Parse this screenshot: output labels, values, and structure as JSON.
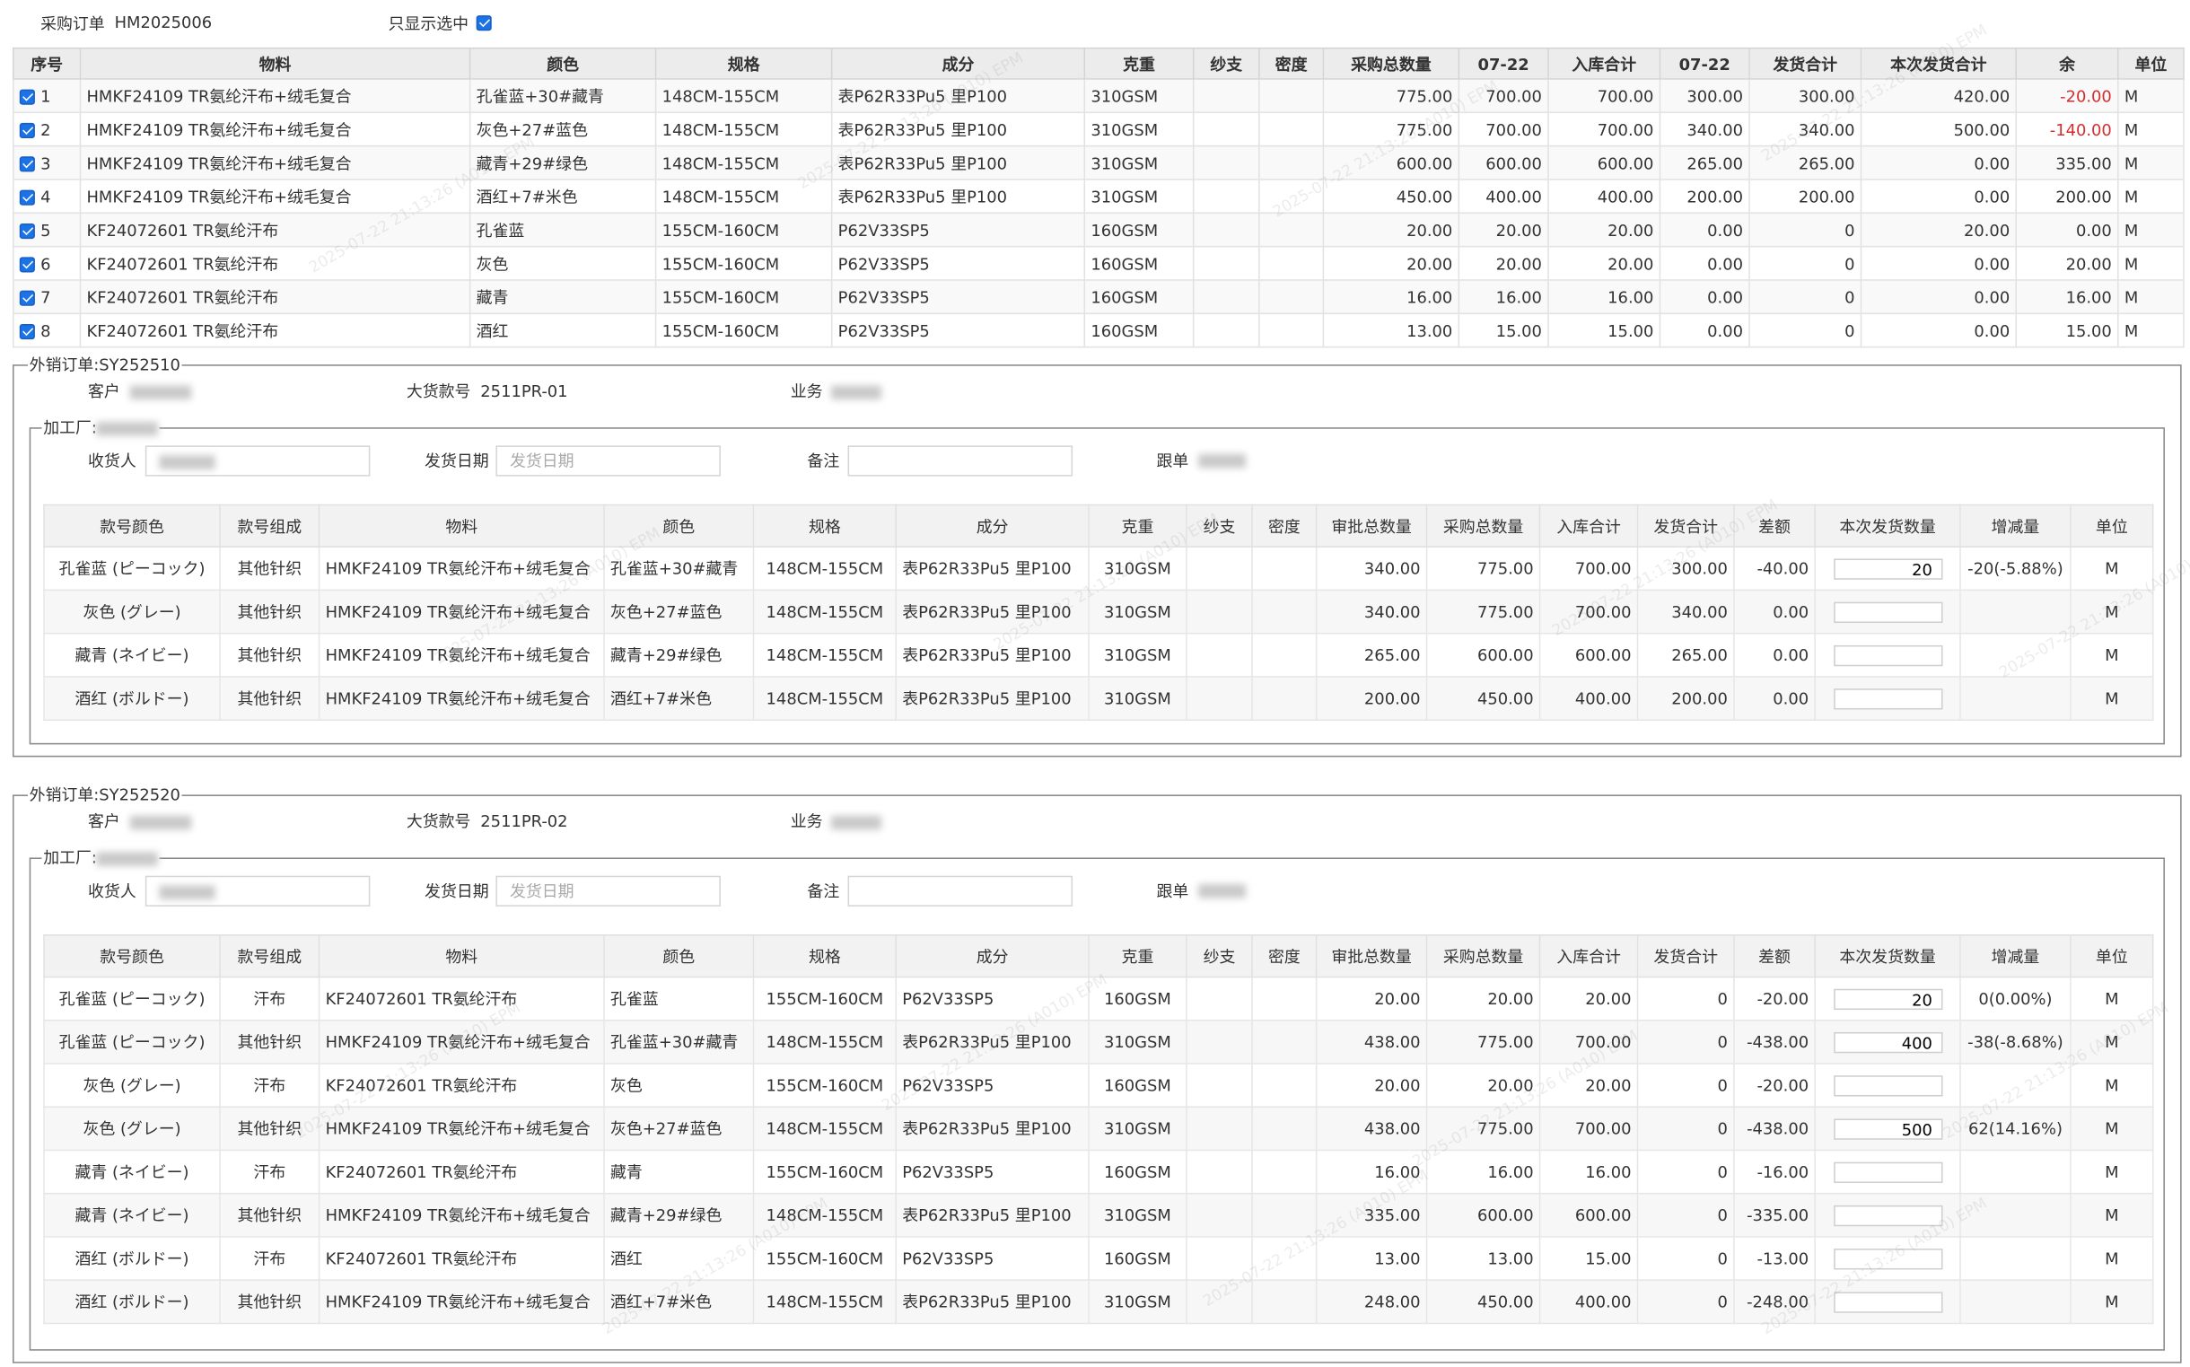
{
  "header": {
    "po_label": "采购订单",
    "po_number": "HM2025006",
    "show_selected_label": "只显示选中"
  },
  "top_table": {
    "columns": [
      "序号",
      "物料",
      "颜色",
      "规格",
      "成分",
      "克重",
      "纱支",
      "密度",
      "采购总数量",
      "07-22",
      "入库合计",
      "07-22",
      "发货合计",
      "本次发货合计",
      "余",
      "单位"
    ],
    "rows": [
      {
        "no": "1",
        "material": "HMKF24109 TR氨纶汗布+绒毛复合",
        "color": "孔雀蓝+30#藏青",
        "spec": "148CM-155CM",
        "comp": "表P62R33Pu5 里P100",
        "weight": "310GSM",
        "yarn": "",
        "density": "",
        "po_qty": "775.00",
        "d1": "700.00",
        "in_total": "700.00",
        "d2": "300.00",
        "ship_total": "300.00",
        "this_ship": "420.00",
        "rest": "-20.00",
        "unit": "M"
      },
      {
        "no": "2",
        "material": "HMKF24109 TR氨纶汗布+绒毛复合",
        "color": "灰色+27#蓝色",
        "spec": "148CM-155CM",
        "comp": "表P62R33Pu5 里P100",
        "weight": "310GSM",
        "yarn": "",
        "density": "",
        "po_qty": "775.00",
        "d1": "700.00",
        "in_total": "700.00",
        "d2": "340.00",
        "ship_total": "340.00",
        "this_ship": "500.00",
        "rest": "-140.00",
        "unit": "M"
      },
      {
        "no": "3",
        "material": "HMKF24109 TR氨纶汗布+绒毛复合",
        "color": "藏青+29#绿色",
        "spec": "148CM-155CM",
        "comp": "表P62R33Pu5 里P100",
        "weight": "310GSM",
        "yarn": "",
        "density": "",
        "po_qty": "600.00",
        "d1": "600.00",
        "in_total": "600.00",
        "d2": "265.00",
        "ship_total": "265.00",
        "this_ship": "0.00",
        "rest": "335.00",
        "unit": "M"
      },
      {
        "no": "4",
        "material": "HMKF24109 TR氨纶汗布+绒毛复合",
        "color": "酒红+7#米色",
        "spec": "148CM-155CM",
        "comp": "表P62R33Pu5 里P100",
        "weight": "310GSM",
        "yarn": "",
        "density": "",
        "po_qty": "450.00",
        "d1": "400.00",
        "in_total": "400.00",
        "d2": "200.00",
        "ship_total": "200.00",
        "this_ship": "0.00",
        "rest": "200.00",
        "unit": "M"
      },
      {
        "no": "5",
        "material": "KF24072601 TR氨纶汗布",
        "color": "孔雀蓝",
        "spec": "155CM-160CM",
        "comp": "P62V33SP5",
        "weight": "160GSM",
        "yarn": "",
        "density": "",
        "po_qty": "20.00",
        "d1": "20.00",
        "in_total": "20.00",
        "d2": "0.00",
        "ship_total": "0",
        "this_ship": "20.00",
        "rest": "0.00",
        "unit": "M"
      },
      {
        "no": "6",
        "material": "KF24072601 TR氨纶汗布",
        "color": "灰色",
        "spec": "155CM-160CM",
        "comp": "P62V33SP5",
        "weight": "160GSM",
        "yarn": "",
        "density": "",
        "po_qty": "20.00",
        "d1": "20.00",
        "in_total": "20.00",
        "d2": "0.00",
        "ship_total": "0",
        "this_ship": "0.00",
        "rest": "20.00",
        "unit": "M"
      },
      {
        "no": "7",
        "material": "KF24072601 TR氨纶汗布",
        "color": "藏青",
        "spec": "155CM-160CM",
        "comp": "P62V33SP5",
        "weight": "160GSM",
        "yarn": "",
        "density": "",
        "po_qty": "16.00",
        "d1": "16.00",
        "in_total": "16.00",
        "d2": "0.00",
        "ship_total": "0",
        "this_ship": "0.00",
        "rest": "16.00",
        "unit": "M"
      },
      {
        "no": "8",
        "material": "KF24072601 TR氨纶汗布",
        "color": "酒红",
        "spec": "155CM-160CM",
        "comp": "P62V33SP5",
        "weight": "160GSM",
        "yarn": "",
        "density": "",
        "po_qty": "13.00",
        "d1": "15.00",
        "in_total": "15.00",
        "d2": "0.00",
        "ship_total": "0",
        "this_ship": "0.00",
        "rest": "15.00",
        "unit": "M"
      }
    ]
  },
  "sub_columns": [
    "款号颜色",
    "款号组成",
    "物料",
    "颜色",
    "规格",
    "成分",
    "克重",
    "纱支",
    "密度",
    "审批总数量",
    "采购总数量",
    "入库合计",
    "发货合计",
    "差额",
    "本次发货数量",
    "增减量",
    "单位"
  ],
  "labels": {
    "customer": "客户",
    "style_no": "大货款号",
    "business": "业务",
    "receiver": "收货人",
    "ship_date": "发货日期",
    "ship_date_placeholder": "发货日期",
    "remark": "备注",
    "follow": "跟单"
  },
  "orders": [
    {
      "legend": "外销订单:SY252510",
      "style_no": "2511PR-01",
      "factory_legend": "加工厂:",
      "rows": [
        {
          "style_color": "孔雀蓝 (ピーコック)",
          "comp_type": "其他针织",
          "material": "HMKF24109 TR氨纶汗布+绒毛复合",
          "color": "孔雀蓝+30#藏青",
          "spec": "148CM-155CM",
          "comp": "表P62R33Pu5 里P100",
          "weight": "310GSM",
          "yarn": "",
          "density": "",
          "approve": "340.00",
          "po": "775.00",
          "in": "700.00",
          "ship": "300.00",
          "diff": "-40.00",
          "qty": "20",
          "delta": "-20(-5.88%)",
          "unit": "M"
        },
        {
          "style_color": "灰色 (グレー)",
          "comp_type": "其他针织",
          "material": "HMKF24109 TR氨纶汗布+绒毛复合",
          "color": "灰色+27#蓝色",
          "spec": "148CM-155CM",
          "comp": "表P62R33Pu5 里P100",
          "weight": "310GSM",
          "yarn": "",
          "density": "",
          "approve": "340.00",
          "po": "775.00",
          "in": "700.00",
          "ship": "340.00",
          "diff": "0.00",
          "qty": "",
          "delta": "",
          "unit": "M"
        },
        {
          "style_color": "藏青 (ネイビー)",
          "comp_type": "其他针织",
          "material": "HMKF24109 TR氨纶汗布+绒毛复合",
          "color": "藏青+29#绿色",
          "spec": "148CM-155CM",
          "comp": "表P62R33Pu5 里P100",
          "weight": "310GSM",
          "yarn": "",
          "density": "",
          "approve": "265.00",
          "po": "600.00",
          "in": "600.00",
          "ship": "265.00",
          "diff": "0.00",
          "qty": "",
          "delta": "",
          "unit": "M"
        },
        {
          "style_color": "酒红 (ボルドー)",
          "comp_type": "其他针织",
          "material": "HMKF24109 TR氨纶汗布+绒毛复合",
          "color": "酒红+7#米色",
          "spec": "148CM-155CM",
          "comp": "表P62R33Pu5 里P100",
          "weight": "310GSM",
          "yarn": "",
          "density": "",
          "approve": "200.00",
          "po": "450.00",
          "in": "400.00",
          "ship": "200.00",
          "diff": "0.00",
          "qty": "",
          "delta": "",
          "unit": "M"
        }
      ]
    },
    {
      "legend": "外销订单:SY252520",
      "style_no": "2511PR-02",
      "factory_legend": "加工厂:",
      "rows": [
        {
          "style_color": "孔雀蓝 (ピーコック)",
          "comp_type": "汗布",
          "material": "KF24072601 TR氨纶汗布",
          "color": "孔雀蓝",
          "spec": "155CM-160CM",
          "comp": "P62V33SP5",
          "weight": "160GSM",
          "yarn": "",
          "density": "",
          "approve": "20.00",
          "po": "20.00",
          "in": "20.00",
          "ship": "0",
          "diff": "-20.00",
          "qty": "20",
          "delta": "0(0.00%)",
          "unit": "M"
        },
        {
          "style_color": "孔雀蓝 (ピーコック)",
          "comp_type": "其他针织",
          "material": "HMKF24109 TR氨纶汗布+绒毛复合",
          "color": "孔雀蓝+30#藏青",
          "spec": "148CM-155CM",
          "comp": "表P62R33Pu5 里P100",
          "weight": "310GSM",
          "yarn": "",
          "density": "",
          "approve": "438.00",
          "po": "775.00",
          "in": "700.00",
          "ship": "0",
          "diff": "-438.00",
          "qty": "400",
          "delta": "-38(-8.68%)",
          "unit": "M"
        },
        {
          "style_color": "灰色 (グレー)",
          "comp_type": "汗布",
          "material": "KF24072601 TR氨纶汗布",
          "color": "灰色",
          "spec": "155CM-160CM",
          "comp": "P62V33SP5",
          "weight": "160GSM",
          "yarn": "",
          "density": "",
          "approve": "20.00",
          "po": "20.00",
          "in": "20.00",
          "ship": "0",
          "diff": "-20.00",
          "qty": "",
          "delta": "",
          "unit": "M"
        },
        {
          "style_color": "灰色 (グレー)",
          "comp_type": "其他针织",
          "material": "HMKF24109 TR氨纶汗布+绒毛复合",
          "color": "灰色+27#蓝色",
          "spec": "148CM-155CM",
          "comp": "表P62R33Pu5 里P100",
          "weight": "310GSM",
          "yarn": "",
          "density": "",
          "approve": "438.00",
          "po": "775.00",
          "in": "700.00",
          "ship": "0",
          "diff": "-438.00",
          "qty": "500",
          "delta": "62(14.16%)",
          "unit": "M"
        },
        {
          "style_color": "藏青 (ネイビー)",
          "comp_type": "汗布",
          "material": "KF24072601 TR氨纶汗布",
          "color": "藏青",
          "spec": "155CM-160CM",
          "comp": "P62V33SP5",
          "weight": "160GSM",
          "yarn": "",
          "density": "",
          "approve": "16.00",
          "po": "16.00",
          "in": "16.00",
          "ship": "0",
          "diff": "-16.00",
          "qty": "",
          "delta": "",
          "unit": "M"
        },
        {
          "style_color": "藏青 (ネイビー)",
          "comp_type": "其他针织",
          "material": "HMKF24109 TR氨纶汗布+绒毛复合",
          "color": "藏青+29#绿色",
          "spec": "148CM-155CM",
          "comp": "表P62R33Pu5 里P100",
          "weight": "310GSM",
          "yarn": "",
          "density": "",
          "approve": "335.00",
          "po": "600.00",
          "in": "600.00",
          "ship": "0",
          "diff": "-335.00",
          "qty": "",
          "delta": "",
          "unit": "M"
        },
        {
          "style_color": "酒红 (ボルドー)",
          "comp_type": "汗布",
          "material": "KF24072601 TR氨纶汗布",
          "color": "酒红",
          "spec": "155CM-160CM",
          "comp": "P62V33SP5",
          "weight": "160GSM",
          "yarn": "",
          "density": "",
          "approve": "13.00",
          "po": "13.00",
          "in": "15.00",
          "ship": "0",
          "diff": "-13.00",
          "qty": "",
          "delta": "",
          "unit": "M"
        },
        {
          "style_color": "酒红 (ボルドー)",
          "comp_type": "其他针织",
          "material": "HMKF24109 TR氨纶汗布+绒毛复合",
          "color": "酒红+7#米色",
          "spec": "148CM-155CM",
          "comp": "表P62R33Pu5 里P100",
          "weight": "310GSM",
          "yarn": "",
          "density": "",
          "approve": "248.00",
          "po": "450.00",
          "in": "400.00",
          "ship": "0",
          "diff": "-248.00",
          "qty": "",
          "delta": "",
          "unit": "M"
        }
      ]
    }
  ],
  "watermark": "2025-07-22 21:13:26 (A010) EPM",
  "colors": {
    "negative": "#d32f2f",
    "checkbox": "#1a73e8",
    "header_bg": "#ececec"
  }
}
